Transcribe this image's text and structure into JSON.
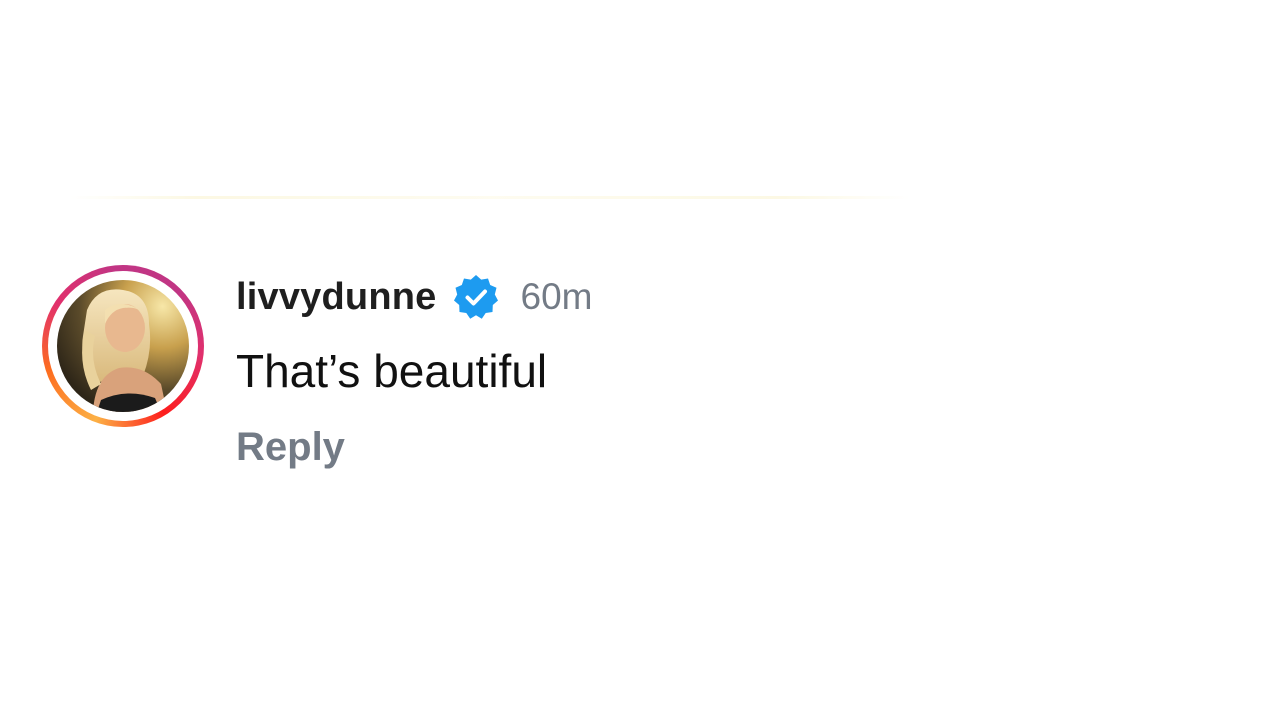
{
  "comment": {
    "username": "livvydunne",
    "verified_icon": "verified-badge-icon",
    "timestamp": "60m",
    "text": "That’s beautiful",
    "reply_label": "Reply"
  },
  "colors": {
    "verified_blue": "#1d9bf0",
    "muted_gray": "#737b86",
    "ring_gradient": [
      "#fcb045",
      "#fd1d1d",
      "#e1306c",
      "#c13584"
    ]
  }
}
